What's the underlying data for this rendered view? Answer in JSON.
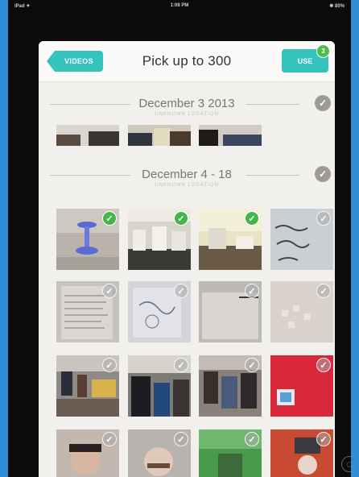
{
  "statusbar": {
    "left": "iPad ✦",
    "time": "1:08 PM",
    "right": "✱ 80%"
  },
  "header": {
    "back_label": "VIDEOS",
    "title": "Pick up to 300",
    "use_label": "USE",
    "use_count": "3"
  },
  "sections": [
    {
      "title": "December 3 2013",
      "subtitle": "UNKNOWN LOCATION"
    },
    {
      "title": "December 4 - 18",
      "subtitle": "UNKNOWN LOCATION"
    }
  ],
  "icons": {
    "check": "✓",
    "bottom": "◯"
  },
  "colors": {
    "accent": "#35c3be",
    "selected": "#43b649"
  }
}
